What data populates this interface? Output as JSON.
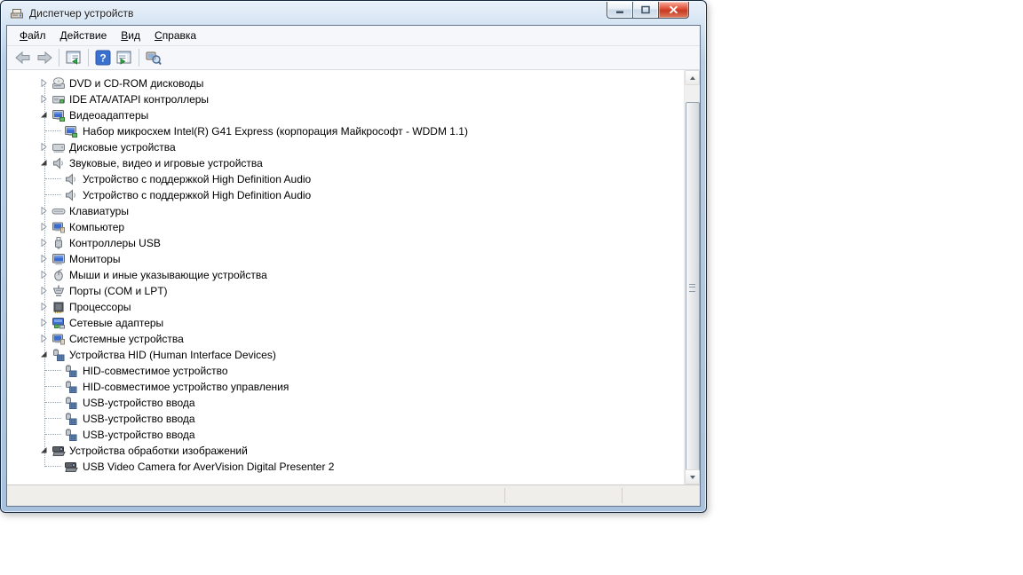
{
  "window": {
    "title": "Диспетчер устройств",
    "controls": [
      {
        "id": "minimize",
        "icon": "minimize-icon"
      },
      {
        "id": "maximize",
        "icon": "maximize-icon"
      },
      {
        "id": "close",
        "icon": "close-icon"
      }
    ]
  },
  "menu": {
    "items": [
      {
        "id": "file",
        "label": "Файл"
      },
      {
        "id": "action",
        "label": "Действие"
      },
      {
        "id": "view",
        "label": "Вид"
      },
      {
        "id": "help",
        "label": "Справка"
      }
    ]
  },
  "toolbar": {
    "items": [
      {
        "type": "button",
        "id": "back",
        "icon": "back-arrow-icon"
      },
      {
        "type": "button",
        "id": "forward",
        "icon": "forward-arrow-icon"
      },
      {
        "type": "separator"
      },
      {
        "type": "button",
        "id": "console-tree",
        "icon": "console-tree-icon"
      },
      {
        "type": "separator"
      },
      {
        "type": "button",
        "id": "help",
        "icon": "help-icon"
      },
      {
        "type": "button",
        "id": "action-pane",
        "icon": "action-pane-icon"
      },
      {
        "type": "separator"
      },
      {
        "type": "button",
        "id": "scan-hardware",
        "icon": "scan-hardware-icon"
      }
    ]
  },
  "tree": {
    "items": [
      {
        "label": "DVD и CD-ROM дисководы",
        "icon": "cd-drive-icon",
        "state": "collapsed",
        "level": 0
      },
      {
        "label": "IDE ATA/ATAPI контроллеры",
        "icon": "ide-controller-icon",
        "state": "collapsed",
        "level": 0
      },
      {
        "label": "Видеоадаптеры",
        "icon": "video-adapter-icon",
        "state": "expanded",
        "level": 0
      },
      {
        "label": "Набор микросхем Intel(R) G41 Express (корпорация Майкрософт - WDDM 1.1)",
        "icon": "video-adapter-icon",
        "state": "leaf",
        "level": 1,
        "last": true
      },
      {
        "label": "Дисковые устройства",
        "icon": "disk-drive-icon",
        "state": "collapsed",
        "level": 0
      },
      {
        "label": "Звуковые, видео и игровые устройства",
        "icon": "speaker-icon",
        "state": "expanded",
        "level": 0
      },
      {
        "label": "Устройство с поддержкой High Definition Audio",
        "icon": "speaker-icon",
        "state": "leaf",
        "level": 1
      },
      {
        "label": "Устройство с поддержкой High Definition Audio",
        "icon": "speaker-icon",
        "state": "leaf",
        "level": 1,
        "last": true
      },
      {
        "label": "Клавиатуры",
        "icon": "keyboard-icon",
        "state": "collapsed",
        "level": 0
      },
      {
        "label": "Компьютер",
        "icon": "computer-icon",
        "state": "collapsed",
        "level": 0
      },
      {
        "label": "Контроллеры USB",
        "icon": "usb-controller-icon",
        "state": "collapsed",
        "level": 0
      },
      {
        "label": "Мониторы",
        "icon": "monitor-icon",
        "state": "collapsed",
        "level": 0
      },
      {
        "label": "Мыши и иные указывающие устройства",
        "icon": "mouse-icon",
        "state": "collapsed",
        "level": 0
      },
      {
        "label": "Порты (COM и LPT)",
        "icon": "port-icon",
        "state": "collapsed",
        "level": 0
      },
      {
        "label": "Процессоры",
        "icon": "processor-icon",
        "state": "collapsed",
        "level": 0
      },
      {
        "label": "Сетевые адаптеры",
        "icon": "network-adapter-icon",
        "state": "collapsed",
        "level": 0
      },
      {
        "label": "Системные устройства",
        "icon": "system-device-icon",
        "state": "collapsed",
        "level": 0
      },
      {
        "label": "Устройства HID (Human Interface Devices)",
        "icon": "hid-device-icon",
        "state": "expanded",
        "level": 0
      },
      {
        "label": "HID-совместимое устройство",
        "icon": "hid-device-icon",
        "state": "leaf",
        "level": 1
      },
      {
        "label": "HID-совместимое устройство управления",
        "icon": "hid-device-icon",
        "state": "leaf",
        "level": 1
      },
      {
        "label": "USB-устройство ввода",
        "icon": "hid-device-icon",
        "state": "leaf",
        "level": 1
      },
      {
        "label": "USB-устройство ввода",
        "icon": "hid-device-icon",
        "state": "leaf",
        "level": 1
      },
      {
        "label": "USB-устройство ввода",
        "icon": "hid-device-icon",
        "state": "leaf",
        "level": 1,
        "last": true
      },
      {
        "label": "Устройства обработки изображений",
        "icon": "imaging-device-icon",
        "state": "expanded",
        "level": 0
      },
      {
        "label": "USB Video Camera for AverVision Digital Presenter 2",
        "icon": "imaging-device-icon",
        "state": "leaf",
        "level": 1,
        "last": true
      }
    ]
  },
  "status_bar": {
    "text": ""
  },
  "colors": {
    "titlebar_blue": "#b9cfe6",
    "frame_border": "#12273f",
    "client_bg": "#f5f7fa",
    "tree_bg": "#ffffff",
    "status_bg": "#f0eeeb",
    "close_red": "#c63a23",
    "help_blue": "#3a70cf"
  }
}
